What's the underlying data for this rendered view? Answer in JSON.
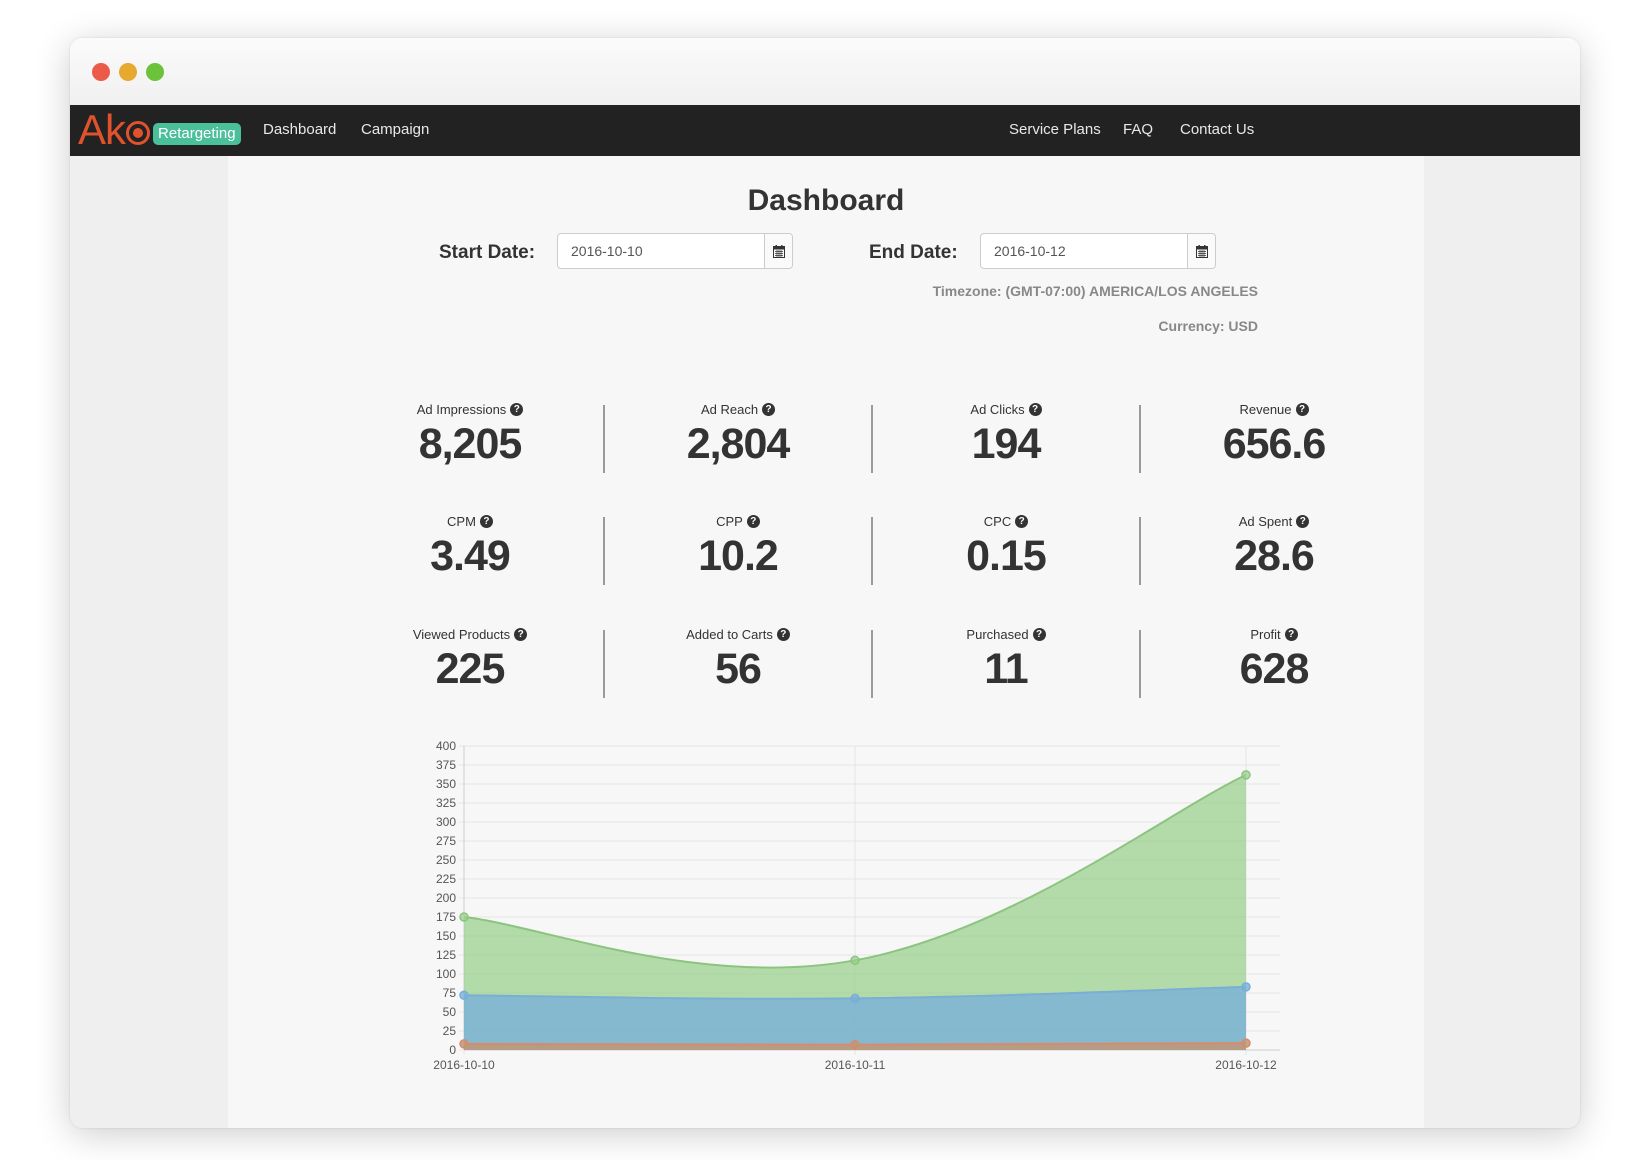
{
  "nav": {
    "logo_badge": "Retargeting",
    "links": [
      "Dashboard",
      "Campaign",
      "Service Plans",
      "FAQ",
      "Contact Us"
    ]
  },
  "page": {
    "title": "Dashboard",
    "start_label": "Start Date:",
    "start_value": "2016-10-10",
    "end_label": "End Date:",
    "end_value": "2016-10-12",
    "timezone": "Timezone: (GMT-07:00) AMERICA/LOS ANGELES",
    "currency": "Currency: USD"
  },
  "stats": [
    {
      "label": "Ad Impressions",
      "value": "8,205"
    },
    {
      "label": "Ad Reach",
      "value": "2,804"
    },
    {
      "label": "Ad Clicks",
      "value": "194"
    },
    {
      "label": "Revenue",
      "value": "656.6"
    },
    {
      "label": "CPM",
      "value": "3.49"
    },
    {
      "label": "CPP",
      "value": "10.2"
    },
    {
      "label": "CPC",
      "value": "0.15"
    },
    {
      "label": "Ad Spent",
      "value": "28.6"
    },
    {
      "label": "Viewed Products",
      "value": "225"
    },
    {
      "label": "Added to Carts",
      "value": "56"
    },
    {
      "label": "Purchased",
      "value": "11"
    },
    {
      "label": "Profit",
      "value": "628"
    }
  ],
  "icons": {
    "help": "question-circle-icon",
    "calendar": "calendar-icon"
  },
  "colors": {
    "navbar": "#222222",
    "green_series": "#97d08a",
    "blue_series": "#7fb3da",
    "orange_series": "#e29b7a"
  },
  "chart_data": {
    "type": "area",
    "x": [
      "2016-10-10",
      "2016-10-11",
      "2016-10-12"
    ],
    "ylim": [
      0,
      400
    ],
    "yticks": [
      0,
      25,
      50,
      75,
      100,
      125,
      150,
      175,
      200,
      225,
      250,
      275,
      300,
      325,
      350,
      375,
      400
    ],
    "grid": true,
    "series": [
      {
        "values": [
          175,
          118,
          362
        ],
        "color": "#97d08a"
      },
      {
        "values": [
          72,
          68,
          83
        ],
        "color": "#7fb3da"
      },
      {
        "values": [
          8,
          7,
          9
        ],
        "color": "#e29b7a"
      }
    ]
  }
}
